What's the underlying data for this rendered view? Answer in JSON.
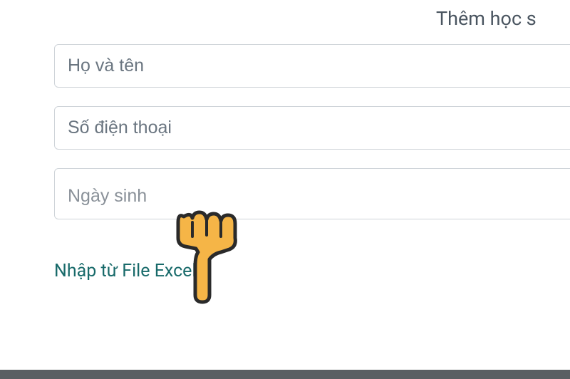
{
  "header": {
    "title": "Thêm học s"
  },
  "form": {
    "name_placeholder": "Họ và tên",
    "phone_placeholder": "Số điện thoại",
    "date_placeholder": "Ngày sinh",
    "import_link_label": "Nhập từ File Excel"
  }
}
